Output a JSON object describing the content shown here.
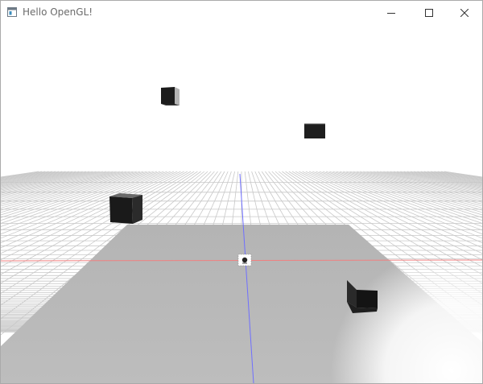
{
  "window": {
    "title": "Hello OpenGL!",
    "icons": {
      "app": "app-window-icon",
      "minimize": "minimize-icon",
      "maximize": "maximize-icon",
      "close": "close-icon"
    }
  },
  "scene": {
    "background_color": "#ffffff",
    "grid_color": "#c8c8c8",
    "floor_color": "#b8b8b8",
    "x_axis_color": "#f08080",
    "y_axis_color": "#6f6fff",
    "cube_color": "#1a1a1a"
  }
}
